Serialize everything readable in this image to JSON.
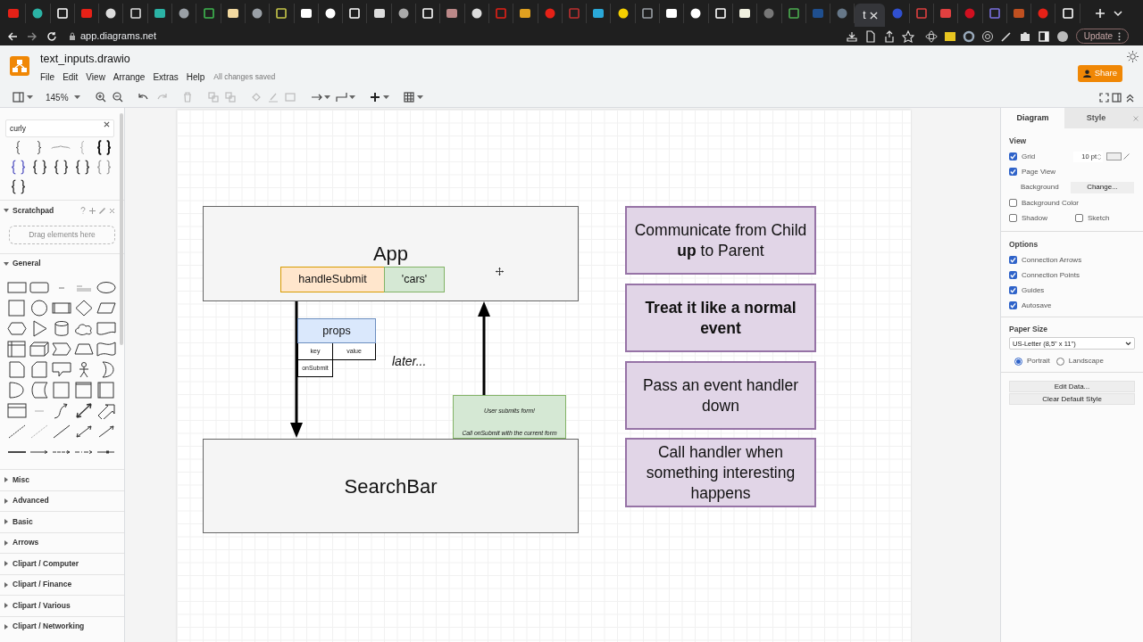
{
  "browser": {
    "active_tab": {
      "label": "t",
      "selected": true
    },
    "url": "app.diagrams.net",
    "update_button": "Update"
  },
  "app": {
    "file_name": "text_inputs.drawio",
    "menu": [
      "File",
      "Edit",
      "View",
      "Arrange",
      "Extras",
      "Help"
    ],
    "save_status": "All changes saved",
    "share_button": "Share"
  },
  "toolbar": {
    "zoom": "145%"
  },
  "sidebar": {
    "search": {
      "value": "curly"
    },
    "scratchpad": {
      "title": "Scratchpad",
      "drop_hint": "Drag elements here"
    },
    "sections": [
      {
        "title": "General",
        "expanded": true
      },
      {
        "title": "Misc",
        "expanded": false
      },
      {
        "title": "Advanced",
        "expanded": false
      },
      {
        "title": "Basic",
        "expanded": false
      },
      {
        "title": "Arrows",
        "expanded": false
      },
      {
        "title": "Clipart / Computer",
        "expanded": false
      },
      {
        "title": "Clipart / Finance",
        "expanded": false
      },
      {
        "title": "Clipart / Various",
        "expanded": false
      },
      {
        "title": "Clipart / Networking",
        "expanded": false
      }
    ]
  },
  "diagram": {
    "app_component": {
      "label": "App",
      "state": [
        {
          "kind": "function",
          "text": "handleSubmit"
        },
        {
          "kind": "value",
          "text": "'cars'"
        }
      ]
    },
    "props_table": {
      "title": "props",
      "columns": [
        "key",
        "value"
      ],
      "rows": [
        "onSubmit"
      ]
    },
    "annotation": "later...",
    "event_note": {
      "lines": [
        "User submits form!",
        "Call onSubmit with the current form"
      ]
    },
    "child_component": {
      "label": "SearchBar"
    },
    "notes": [
      {
        "text": "Communicate from Child **up** to Parent",
        "bold": false
      },
      {
        "text": "Treat it like a normal event",
        "bold": true
      },
      {
        "text": "Pass an event handler down",
        "bold": false
      },
      {
        "text": "Call handler when something interesting happens",
        "bold": false
      }
    ]
  },
  "format_panel": {
    "tabs": [
      {
        "label": "Diagram",
        "selected": true
      },
      {
        "label": "Style",
        "selected": false
      }
    ],
    "view": {
      "title": "View",
      "grid": {
        "label": "Grid",
        "checked": true,
        "size": "10 pt"
      },
      "page_view": {
        "label": "Page View",
        "checked": true
      },
      "background": {
        "label": "Background",
        "button": "Change..."
      },
      "background_color": {
        "label": "Background Color",
        "checked": false
      },
      "shadow": {
        "label": "Shadow",
        "checked": false
      },
      "sketch": {
        "label": "Sketch",
        "checked": false
      }
    },
    "options": {
      "title": "Options",
      "checkboxes": [
        {
          "label": "Connection Arrows",
          "checked": true
        },
        {
          "label": "Connection Points",
          "checked": true
        },
        {
          "label": "Guides",
          "checked": true
        },
        {
          "label": "Autosave",
          "checked": true
        }
      ]
    },
    "paper_size": {
      "title": "Paper Size",
      "value": "US-Letter (8,5\" x 11\")",
      "orientation": [
        {
          "label": "Portrait",
          "selected": true
        },
        {
          "label": "Landscape",
          "selected": false
        }
      ]
    },
    "buttons": [
      "Edit Data...",
      "Clear Default Style"
    ]
  }
}
